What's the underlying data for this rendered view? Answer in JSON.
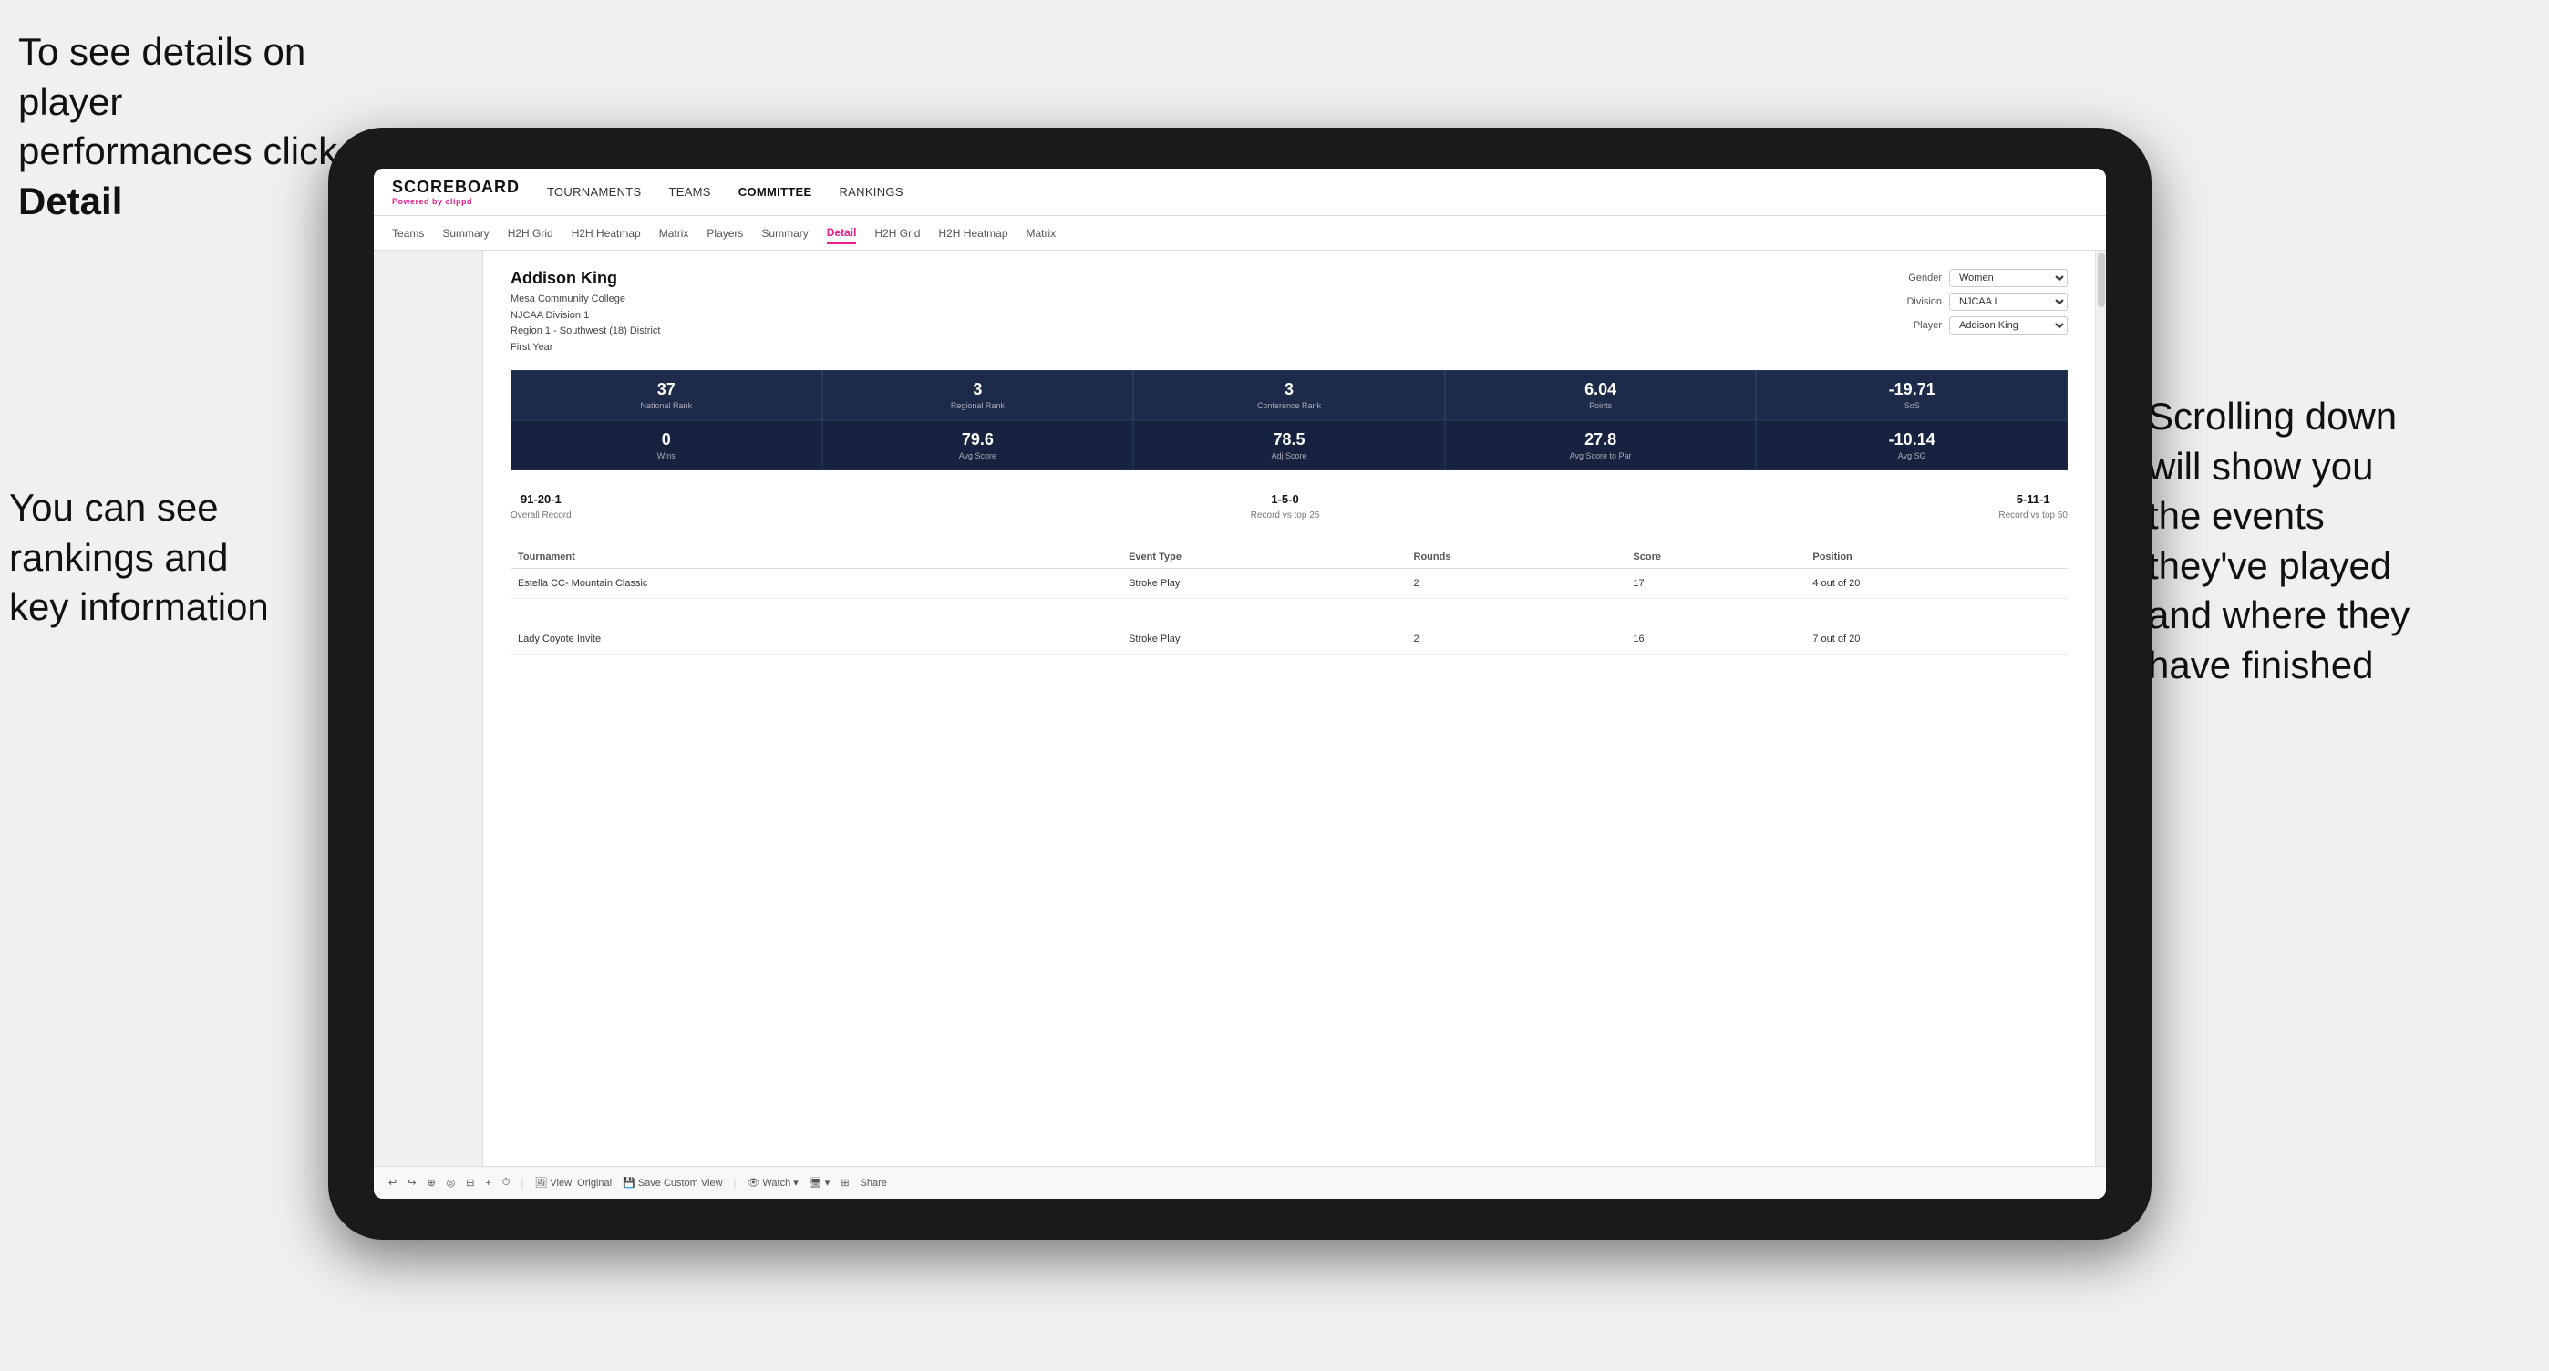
{
  "annotations": {
    "top_left": "To see details on player performances click ",
    "top_left_bold": "Detail",
    "bottom_left_line1": "You can see",
    "bottom_left_line2": "rankings and",
    "bottom_left_line3": "key information",
    "right_line1": "Scrolling down",
    "right_line2": "will show you",
    "right_line3": "the events",
    "right_line4": "they've played",
    "right_line5": "and where they",
    "right_line6": "have finished"
  },
  "nav": {
    "logo": "SCOREBOARD",
    "logo_sub": "Powered by ",
    "logo_sub_brand": "clippd",
    "items": [
      "TOURNAMENTS",
      "TEAMS",
      "COMMITTEE",
      "RANKINGS"
    ]
  },
  "secondary_tabs": {
    "tabs": [
      "Teams",
      "Summary",
      "H2H Grid",
      "H2H Heatmap",
      "Matrix",
      "Players",
      "Summary",
      "Detail",
      "H2H Grid",
      "H2H Heatmap",
      "Matrix"
    ],
    "active": "Detail"
  },
  "player": {
    "name": "Addison King",
    "school": "Mesa Community College",
    "division": "NJCAA Division 1",
    "region": "Region 1 - Southwest (18) District",
    "year": "First Year"
  },
  "filters": {
    "gender_label": "Gender",
    "gender_value": "Women",
    "division_label": "Division",
    "division_value": "NJCAA I",
    "player_label": "Player",
    "player_value": "Addison King"
  },
  "stats_row1": [
    {
      "value": "37",
      "label": "National Rank"
    },
    {
      "value": "3",
      "label": "Regional Rank"
    },
    {
      "value": "3",
      "label": "Conference Rank"
    },
    {
      "value": "6.04",
      "label": "Points"
    },
    {
      "value": "-19.71",
      "label": "SoS"
    }
  ],
  "stats_row2": [
    {
      "value": "0",
      "label": "Wins"
    },
    {
      "value": "79.6",
      "label": "Avg Score"
    },
    {
      "value": "78.5",
      "label": "Adj Score"
    },
    {
      "value": "27.8",
      "label": "Avg Score to Par"
    },
    {
      "value": "-10.14",
      "label": "Avg SG"
    }
  ],
  "records": [
    {
      "value": "91-20-1",
      "label": "Overall Record"
    },
    {
      "value": "1-5-0",
      "label": "Record vs top 25"
    },
    {
      "value": "5-11-1",
      "label": "Record vs top 50"
    }
  ],
  "table": {
    "headers": [
      "Tournament",
      "Event Type",
      "Rounds",
      "Score",
      "Position"
    ],
    "rows": [
      {
        "tournament": "Estella CC- Mountain Classic",
        "event_type": "Stroke Play",
        "rounds": "2",
        "score": "17",
        "position": "4 out of 20"
      },
      {
        "tournament": "",
        "event_type": "",
        "rounds": "",
        "score": "",
        "position": ""
      },
      {
        "tournament": "Lady Coyote Invite",
        "event_type": "Stroke Play",
        "rounds": "2",
        "score": "16",
        "position": "7 out of 20"
      }
    ]
  },
  "toolbar": {
    "items": [
      "↩",
      "↪",
      "⊕",
      "◎",
      "⊟",
      "+",
      "⏱",
      "View: Original",
      "Save Custom View",
      "Watch ▾",
      "🖥 ▾",
      "⊞",
      "Share"
    ]
  }
}
